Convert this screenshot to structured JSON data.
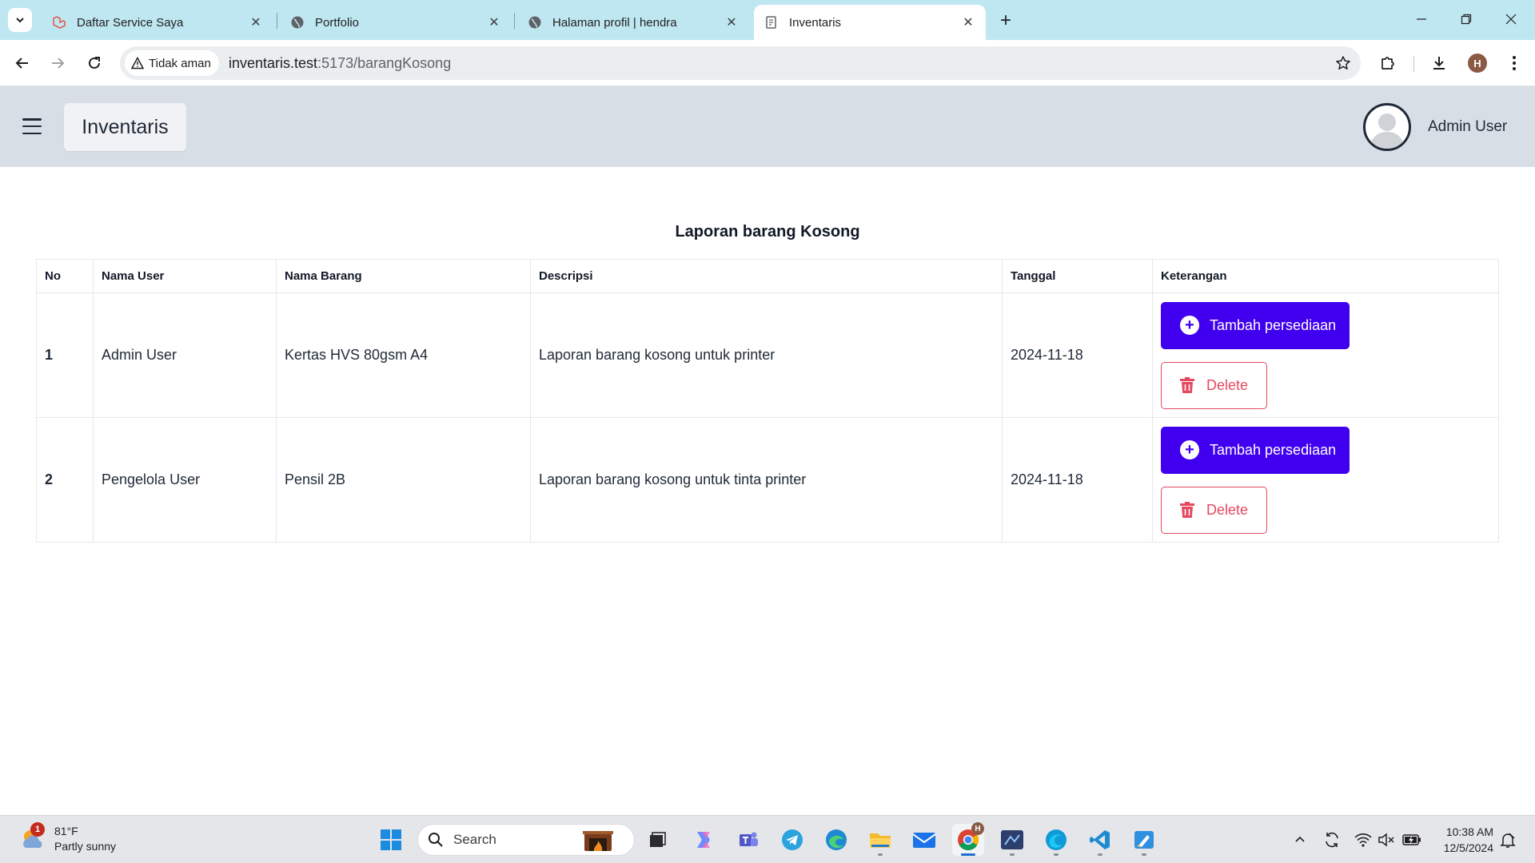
{
  "browser": {
    "tabs": [
      {
        "title": "Daftar Service Saya",
        "icon": "laravel-icon",
        "active": false
      },
      {
        "title": "Portfolio",
        "icon": "globe-icon",
        "active": false
      },
      {
        "title": "Halaman profil | hendra",
        "icon": "globe-icon",
        "active": false
      },
      {
        "title": "Inventaris",
        "icon": "document-icon",
        "active": true
      }
    ],
    "security_label": "Tidak aman",
    "url_host": "inventaris.test",
    "url_rest": ":5173/barangKosong",
    "profile_initial": "H"
  },
  "header": {
    "brand": "Inventaris",
    "user_name": "Admin User"
  },
  "report": {
    "title": "Laporan barang Kosong",
    "columns": [
      "No",
      "Nama User",
      "Nama Barang",
      "Descripsi",
      "Tanggal",
      "Keterangan"
    ],
    "rows": [
      {
        "no": "1",
        "user": "Admin User",
        "item": "Kertas HVS 80gsm A4",
        "description": "Laporan barang kosong untuk printer",
        "date": "2024-11-18"
      },
      {
        "no": "2",
        "user": "Pengelola User",
        "item": "Pensil 2B",
        "description": "Laporan barang kosong untuk tinta printer",
        "date": "2024-11-18"
      }
    ],
    "add_stock_label": "Tambah persediaan",
    "delete_label": "Delete",
    "colors": {
      "primary": "#4000ef",
      "danger": "#e5485f"
    }
  },
  "taskbar": {
    "weather_temp": "81°F",
    "weather_desc": "Partly sunny",
    "weather_badge": "1",
    "search_label": "Search",
    "chrome_badge": "H",
    "time": "10:38 AM",
    "date": "12/5/2024"
  }
}
